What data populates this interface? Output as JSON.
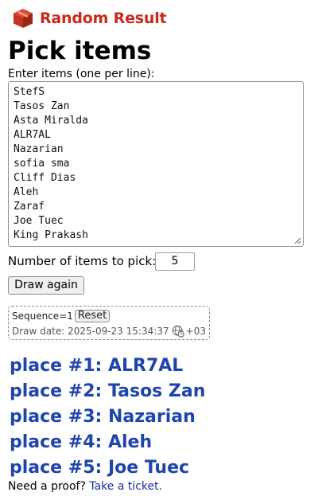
{
  "header": {
    "logo_text": "Random Result"
  },
  "page": {
    "title": "Pick items"
  },
  "items_input": {
    "label": "Enter items (one per line):",
    "lines": [
      "StefS",
      "Tasos Zan",
      "Asta Miralda",
      "ALR7AL",
      "Nazarian",
      "sofia sma",
      "Cliff Dias",
      "Aleh",
      "Zaraf",
      "Joe Tuec",
      "King Prakash"
    ]
  },
  "pick_count": {
    "label": "Number of items to pick:",
    "value": "5"
  },
  "draw_button": {
    "label": "Draw again"
  },
  "sequence": {
    "label": "Sequence=1",
    "reset_label": "Reset",
    "draw_date_label": "Draw date: 2025-09-23 15:34:37",
    "timezone": "+03"
  },
  "results": [
    "place #1: ALR7AL",
    "place #2: Tasos Zan",
    "place #3: Nazarian",
    "place #4: Aleh",
    "place #5: Joe Tuec"
  ],
  "proof": {
    "text": "Need a proof?",
    "link_label": "Take a ticket."
  },
  "colors": {
    "brand_red": "#c92a1c",
    "result_blue": "#1f45ad",
    "link_blue": "#1c2c9e"
  }
}
